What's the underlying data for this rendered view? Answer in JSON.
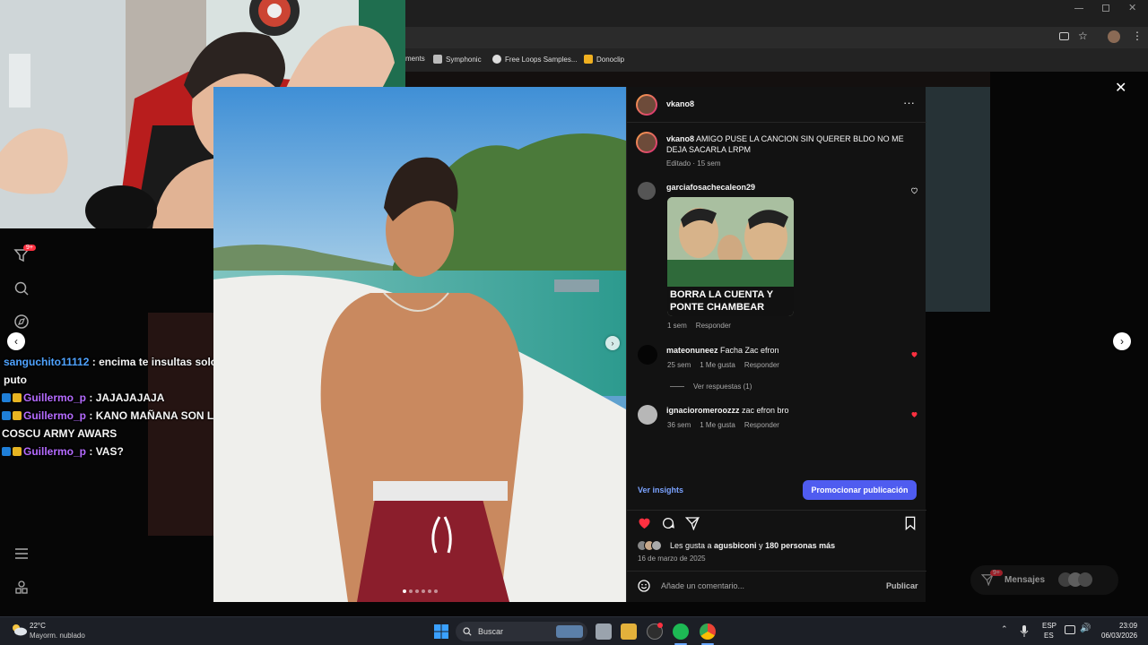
{
  "browser": {
    "bookmarks": [
      {
        "label": "ments"
      },
      {
        "label": "Symphonic"
      },
      {
        "label": "Free Loops Samples..."
      },
      {
        "label": "Donoclip"
      }
    ]
  },
  "chat": {
    "messages": [
      {
        "user": "sanguchito11112",
        "text": ": encima te insultas solo vendido puto"
      },
      {
        "user": "Guillermo_p",
        "text": ": JAJAJAJAJA"
      },
      {
        "user": "Guillermo_p",
        "text": ": KANO MAÑANA SON LOS COSCU ARMY AWARS"
      },
      {
        "user": "Guillermo_p",
        "text": ": VAS?"
      }
    ],
    "notification_count": "9+"
  },
  "post": {
    "author": "vkano8",
    "caption": {
      "user": "vkano8",
      "text": "AMIGO PUSE LA CANCION SIN QUERER BLDO NO ME DEJA SACARLA LRPM",
      "meta": "Editado · 15 sem"
    },
    "comments": [
      {
        "user": "garciafosachecaleon29",
        "meme_text": "BORRA LA CUENTA Y PONTE CHAMBEAR",
        "time": "1 sem",
        "reply": "Responder"
      },
      {
        "user": "mateonuneez",
        "text": "Facha Zac efron",
        "time": "25 sem",
        "likes": "1 Me gusta",
        "reply": "Responder",
        "view_replies": "Ver respuestas (1)"
      },
      {
        "user": "ignacioromeroozzz",
        "text": "zac efron bro",
        "time": "36 sem",
        "likes": "1 Me gusta",
        "reply": "Responder"
      }
    ],
    "insights_label": "Ver insights",
    "promote_label": "Promocionar publicación",
    "likes_prefix": "Les gusta a ",
    "likes_user": "agusbiconi",
    "likes_mid": " y ",
    "likes_count": "180 personas más",
    "date": "16 de marzo de 2025",
    "add_comment_placeholder": "Añade un comentario...",
    "publish_label": "Publicar"
  },
  "messages_bar": {
    "label": "Mensajes",
    "count": "9+"
  },
  "taskbar": {
    "weather_temp": "22°C",
    "weather_desc": "Mayorm. nublado",
    "search_label": "Buscar",
    "lang_top": "ESP",
    "lang_bottom": "ES",
    "time": "23:09",
    "date": "06/03/2026"
  },
  "colors": {
    "accent": "#4f5cf0",
    "like_red": "#ff3040",
    "link_blue": "#7aa2ff"
  }
}
